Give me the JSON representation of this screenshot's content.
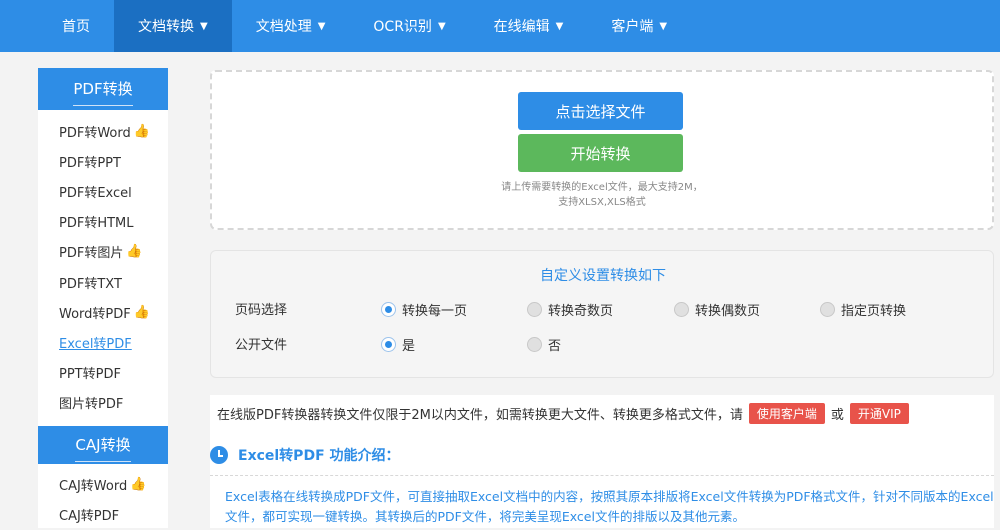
{
  "nav": {
    "items": [
      {
        "label": "首页",
        "caret": ""
      },
      {
        "label": "文档转换",
        "caret": "▼"
      },
      {
        "label": "文档处理",
        "caret": "▼"
      },
      {
        "label": "OCR识别",
        "caret": "▼"
      },
      {
        "label": "在线编辑",
        "caret": "▼"
      },
      {
        "label": "客户端",
        "caret": "▼"
      }
    ]
  },
  "sidebar": {
    "pdf_header": "PDF转换",
    "pdf_items": [
      {
        "label": "PDF转Word",
        "hand": "👍"
      },
      {
        "label": "PDF转PPT",
        "hand": ""
      },
      {
        "label": "PDF转Excel",
        "hand": ""
      },
      {
        "label": "PDF转HTML",
        "hand": ""
      },
      {
        "label": "PDF转图片",
        "hand": "👍"
      },
      {
        "label": "PDF转TXT",
        "hand": ""
      },
      {
        "label": "Word转PDF",
        "hand": "👍"
      },
      {
        "label": "Excel转PDF",
        "hand": ""
      },
      {
        "label": "PPT转PDF",
        "hand": ""
      },
      {
        "label": "图片转PDF",
        "hand": ""
      }
    ],
    "caj_header": "CAJ转换",
    "caj_items": [
      {
        "label": "CAJ转Word",
        "hand": "👍"
      },
      {
        "label": "CAJ转PDF",
        "hand": ""
      }
    ]
  },
  "upload": {
    "select_label": "点击选择文件",
    "start_label": "开始转换",
    "tip_line1": "请上传需要转换的Excel文件，最大支持2M，",
    "tip_line2": "支持XLSX,XLS格式"
  },
  "settings": {
    "title": "自定义设置转换如下",
    "page_label": "页码选择",
    "page_options": [
      "转换每一页",
      "转换奇数页",
      "转换偶数页",
      "指定页转换"
    ],
    "public_label": "公开文件",
    "public_options": [
      "是",
      "否"
    ]
  },
  "notice": {
    "text": "在线版PDF转换器转换文件仅限于2M以内文件，如需转换更大文件、转换更多格式文件，请",
    "client_button": "使用客户端",
    "or": "或",
    "vip_button": "开通VIP"
  },
  "intro": {
    "title": "Excel转PDF 功能介绍：",
    "text": "Excel表格在线转换成PDF文件，可直接抽取Excel文档中的内容，按照其原本排版将Excel文件转换为PDF格式文件，针对不同版本的Excel文件，都可实现一键转换。其转换后的PDF文件，将完美呈现Excel文件的排版以及其他元素。"
  }
}
